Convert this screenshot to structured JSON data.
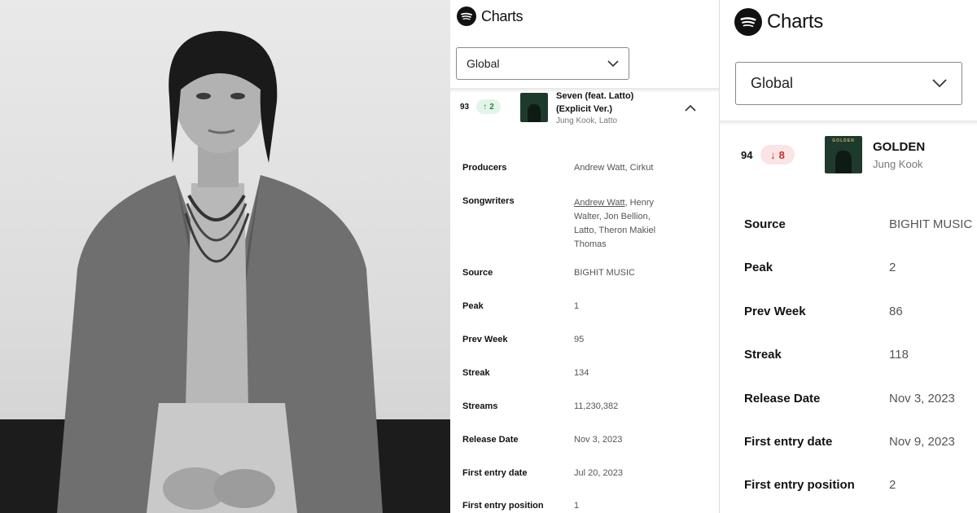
{
  "photo": {
    "alt": ""
  },
  "panel_a": {
    "brand_title": "Charts",
    "region_select": "Global",
    "track": {
      "rank": "93",
      "delta": "2",
      "delta_direction": "up",
      "title_line1": "Seven (feat. Latto)",
      "title_line2": "(Explicit Ver.)",
      "artists": "Jung Kook, Latto"
    },
    "details": [
      {
        "label": "Producers",
        "value": "Andrew Watt, Cirkut"
      },
      {
        "label": "Songwriters",
        "value_link": "Andrew Watt",
        "value_rest": ", Henry",
        "value_lines": [
          "Walter, Jon Bellion,",
          "Latto, Theron Makiel",
          "Thomas"
        ]
      },
      {
        "label": "Source",
        "value": "BIGHIT MUSIC"
      },
      {
        "label": "Peak",
        "value": "1"
      },
      {
        "label": "Prev Week",
        "value": "95"
      },
      {
        "label": "Streak",
        "value": "134"
      },
      {
        "label": "Streams",
        "value": "11,230,382"
      },
      {
        "label": "Release Date",
        "value": "Nov 3, 2023"
      },
      {
        "label": "First entry date",
        "value": "Jul 20, 2023"
      },
      {
        "label": "First entry position",
        "value": "1"
      }
    ]
  },
  "panel_b": {
    "brand_title": "Charts",
    "region_select": "Global",
    "track": {
      "rank": "94",
      "delta": "8",
      "delta_direction": "down",
      "title": "GOLDEN",
      "artists": "Jung Kook",
      "cover_text": "GOLDEN"
    },
    "details": [
      {
        "label": "Source",
        "value": "BIGHIT MUSIC"
      },
      {
        "label": "Peak",
        "value": "2"
      },
      {
        "label": "Prev Week",
        "value": "86"
      },
      {
        "label": "Streak",
        "value": "118"
      },
      {
        "label": "Release Date",
        "value": "Nov 3, 2023"
      },
      {
        "label": "First entry date",
        "value": "Nov 9, 2023"
      },
      {
        "label": "First entry position",
        "value": "2"
      }
    ]
  },
  "colors": {
    "up": "#1f8a3d",
    "down": "#c62f2f",
    "cover": "#1e3a2c"
  }
}
